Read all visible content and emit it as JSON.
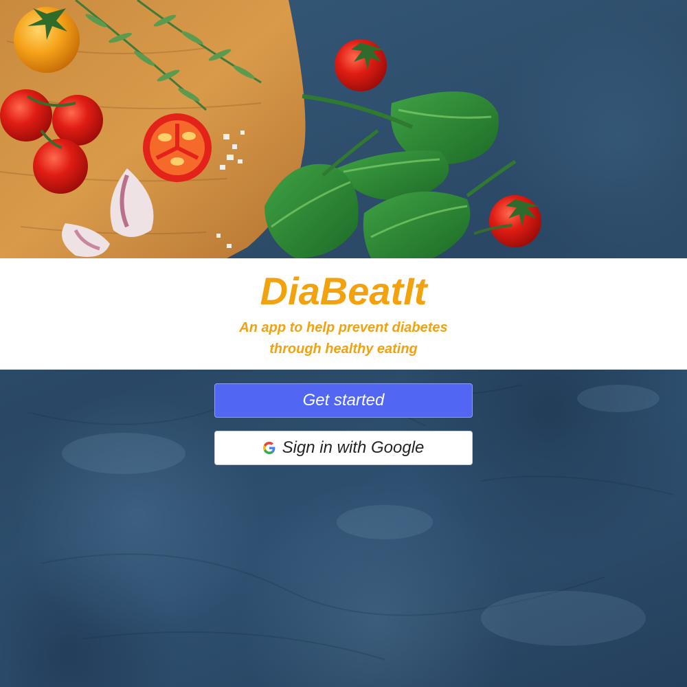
{
  "app": {
    "title": "DiaBeatIt",
    "tagline_line1": "An app to help prevent diabetes",
    "tagline_line2": "through healthy eating"
  },
  "actions": {
    "get_started_label": "Get started",
    "google_signin_label": "Sign in with Google"
  },
  "icons": {
    "google": "google-g-icon"
  },
  "colors": {
    "brand_orange": "#f2a20f",
    "primary_button": "#5166f2",
    "background_slate": "#2d4a66",
    "band_white": "#ffffff"
  }
}
